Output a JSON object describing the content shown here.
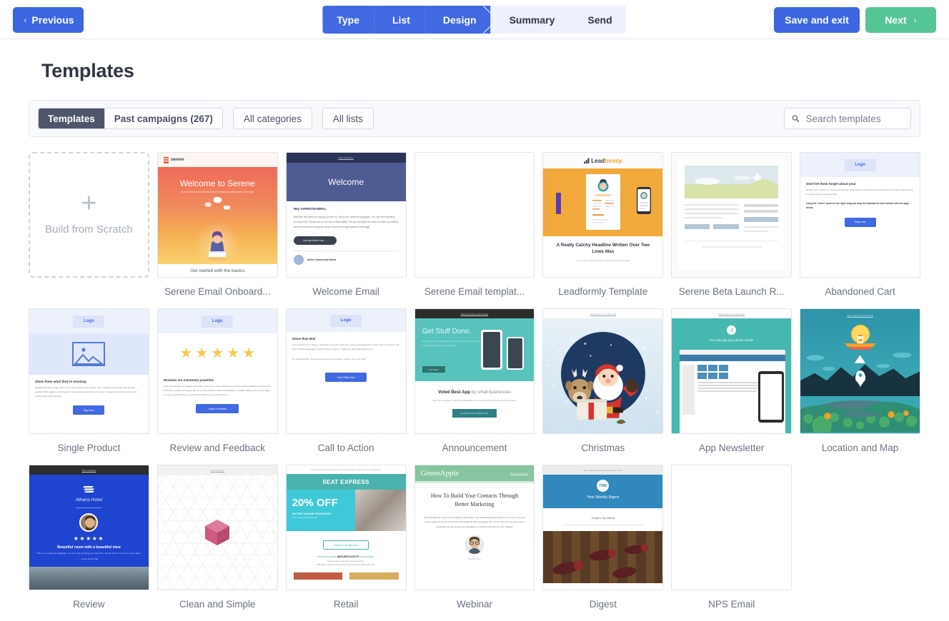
{
  "topbar": {
    "previous_label": "Previous",
    "previous_icon": "chevron-left-icon",
    "save_label": "Save and exit",
    "next_label": "Next",
    "next_icon": "chevron-right-icon",
    "accent_blue": "#3b66e0",
    "accent_green": "#56c596",
    "steps": [
      {
        "label": "Type",
        "active": true
      },
      {
        "label": "List",
        "active": true
      },
      {
        "label": "Design",
        "active": true
      },
      {
        "label": "Summary",
        "active": false
      },
      {
        "label": "Send",
        "active": false
      }
    ]
  },
  "page": {
    "title": "Templates"
  },
  "filters": {
    "segments": [
      {
        "label": "Templates",
        "selected": true
      },
      {
        "label": "Past campaigns (267)",
        "selected": false
      }
    ],
    "dropdowns": [
      {
        "label": "All categories"
      },
      {
        "label": "All lists"
      }
    ],
    "search": {
      "placeholder": "Search templates",
      "value": "",
      "icon": "search-icon"
    }
  },
  "scratch_card": {
    "label": "Build from Scratch",
    "icon": "plus-icon"
  },
  "templates": [
    {
      "id": "serene-onboarding",
      "caption": "Serene Email Onboard...",
      "preview": {
        "brand": "serene",
        "headline": "Welcome to Serene",
        "subline": "You're about to find the best way to bring your team work, every day.",
        "footer": "Get started with the basics"
      }
    },
    {
      "id": "welcome-email",
      "caption": "Welcome Email",
      "preview": {
        "view_in_browser": "View in Browser",
        "hero": "Welcome",
        "greeting": "Hey %FIRSTNAME%,",
        "body": "Welcome and thanks for signing up with us. This is your welcome paragraph. You can write anything you want here. Simply click on the text to start editing. You can also style this area of content by clicking on the text and then using the options found in the right sidebar of this page.",
        "button": "Let's go there now →",
        "footer": "Active Community Board"
      }
    },
    {
      "id": "serene-email-template",
      "caption": "Serene Email templat...",
      "preview": {
        "blank": true
      }
    },
    {
      "id": "leadformly-template",
      "caption": "Leadformly Template",
      "preview": {
        "logo": "Leadformly",
        "headline": "A Really Catchy Headline Written Over Two Lines Max",
        "subline": "One or two sentence reason briefly explaining the value"
      }
    },
    {
      "id": "serene-beta-launch",
      "caption": "Serene Beta Launch R...",
      "preview": {
        "skeleton": true
      }
    },
    {
      "id": "abandoned-cart",
      "caption": "Abandoned Cart",
      "preview": {
        "logo": "Logo",
        "headline": "Don't let them forget about you!",
        "body": "Prompt your customer to revisit your store by showing them the products they left behind. Consider offering them a coupon code to close the deal.",
        "body2": "Using the \"Insert\" panel on the right, drag and drop the Abandoned Cart element onto the page below.",
        "button": "Shop now"
      }
    },
    {
      "id": "single-product",
      "caption": "Single Product",
      "preview": {
        "logo": "Logo",
        "headline": "Show them what they're missing.",
        "body": "Replace the above image with a nice, clean shot of your product. Then, describe what makes this product special. What makes it worth buying? Use language that delivers a sense of urgency and focus on the most exciting parts of the product.",
        "button": "Buy Now"
      }
    },
    {
      "id": "review-and-feedback",
      "caption": "Review and Feedback",
      "preview": {
        "logo": "Logo",
        "stars": 5,
        "headline": "Reviews are extremely powerful.",
        "body": "If you can identify your biggest advocates, reach out to them and ask for a review. Social validation can help grow a business quickly and organically, so don't be afraid to solicit this feedback. Consider adding a link to your page on Yelp, Google Reviews, or the review platform you are focused on.",
        "button": "Leave a Review"
      }
    },
    {
      "id": "call-to-action",
      "caption": "Call to Action",
      "preview": {
        "logo": "Logo",
        "headline": "Close that deal",
        "body": "Your customer is so close to converting, they just need some extra encouragement. In this email, you want to use time sensitive language to instil a sense of urgency. Make sure they take action now!",
        "body2": "Try something like \"This opportunity won't last forever, reserve your spot now!\"",
        "button": "Don't Miss Out"
      }
    },
    {
      "id": "announcement",
      "caption": "Announcement",
      "preview": {
        "view_in_browser": "View this email in your browser",
        "headline": "Get Stuff Done.",
        "subline": "Simple and intuitive interface allow for seamless interaction and collaboration between team members.",
        "button": "Learn More",
        "body_bold": "Voted Best App",
        "body_rest": " by small businesses",
        "body_sub": "View your message, backup and interactions from one team anywhere anytime at any time.",
        "cta": "DOWNLOAD FREE APP"
      }
    },
    {
      "id": "christmas",
      "caption": "Christmas",
      "preview": {
        "view_in_browser": "View a web copy of this email"
      }
    },
    {
      "id": "app-newsletter",
      "caption": "App Newsletter",
      "preview": {
        "view_in_browser": "View a web copy of this email",
        "tagline": "The only app your phone needs."
      }
    },
    {
      "id": "location-and-map",
      "caption": "Location and Map",
      "preview": {
        "view_in_browser": "View a web copy of this email"
      }
    },
    {
      "id": "review",
      "caption": "Review",
      "preview": {
        "view_in_browser": "View in browser",
        "brand": "Athens Hotel",
        "stars": 5,
        "headline": "Beautiful room with a beautiful view",
        "body": "This is your welcome paragraph. You can write anything you want here. Simply click on the text to start editing.",
        "attribution": "— Hotel Scroll, Italy"
      }
    },
    {
      "id": "clean-and-simple",
      "caption": "Clean and Simple",
      "preview": {
        "view_in_browser": "View in browser"
      }
    },
    {
      "id": "retail",
      "caption": "Retail",
      "preview": {
        "view_in_browser": "View this email in your browser. If you no longer wish to receive from us, unsubscribe.",
        "band": "SEAT EXPRESS",
        "discount": "20% OFF",
        "discount_sub": "ENTIRE ONLINE PURCHASE",
        "discount_fine": "Promo code ends this Sunday",
        "cta": "Redeem my discount",
        "promo_pre": "Use promo code ",
        "promo_code": "ABCDEFG123XYZ",
        "promo_post": " for purchase.",
        "fine1": "Discount will be reflected in total at checkout.",
        "fine2": "20% offer is valid on first purchase made through our online store only."
      }
    },
    {
      "id": "webinar",
      "caption": "Webinar",
      "preview": {
        "logo": "GreenApple",
        "view_in_browser": "View in web browser",
        "headline": "How To Build Your Contacts Through Better Marketing",
        "body": "Not building your contacts fast enough for your liking? Your marketing approach may be all wrong. Join Sean in this webinar as he will discuss how marketing through GreenApple Plus can not only increase your contact acquisition, but also increase the throughput of potential customers to your company.",
        "caption_name": "Sean Hall, Host"
      }
    },
    {
      "id": "digest",
      "caption": "Digest",
      "preview": {
        "view_in_browser": "Have issues viewing this email? Learn more",
        "logo": "YWD",
        "title": "Your Weekly Digest",
        "section": "Today's Top Article"
      }
    },
    {
      "id": "nps-email",
      "caption": "NPS Email",
      "preview": {
        "blank": true
      }
    }
  ]
}
